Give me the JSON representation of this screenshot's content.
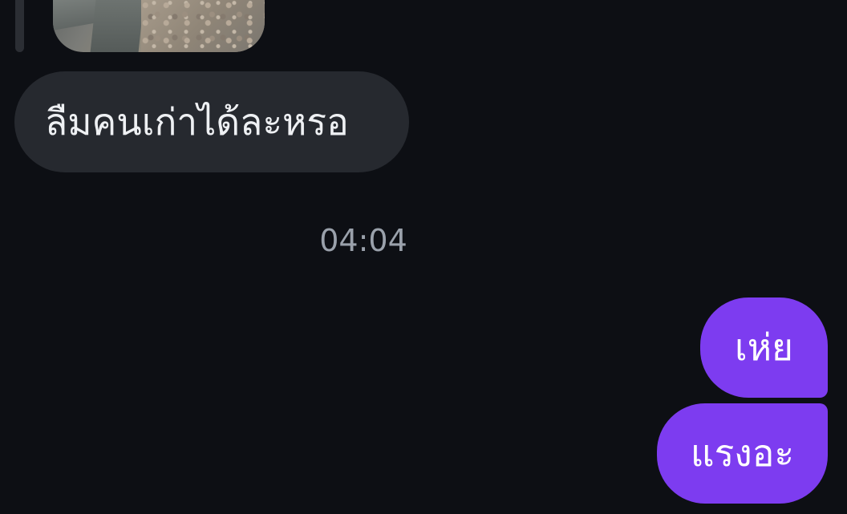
{
  "messages": {
    "incoming": [
      {
        "type": "image",
        "image_icon": "photo-thumbnail-rocks"
      },
      {
        "type": "text",
        "text": "ลืมคนเก่าได้ละหรอ"
      }
    ],
    "timestamp": "04:04",
    "outgoing": [
      {
        "type": "text",
        "text": "เห่ย"
      },
      {
        "type": "text",
        "text": "แรงอะ"
      }
    ]
  },
  "colors": {
    "background": "#0d0f14",
    "incoming_bubble": "#26292f",
    "outgoing_bubble": "#7d3cf0",
    "timestamp_text": "#9aa1ab"
  }
}
